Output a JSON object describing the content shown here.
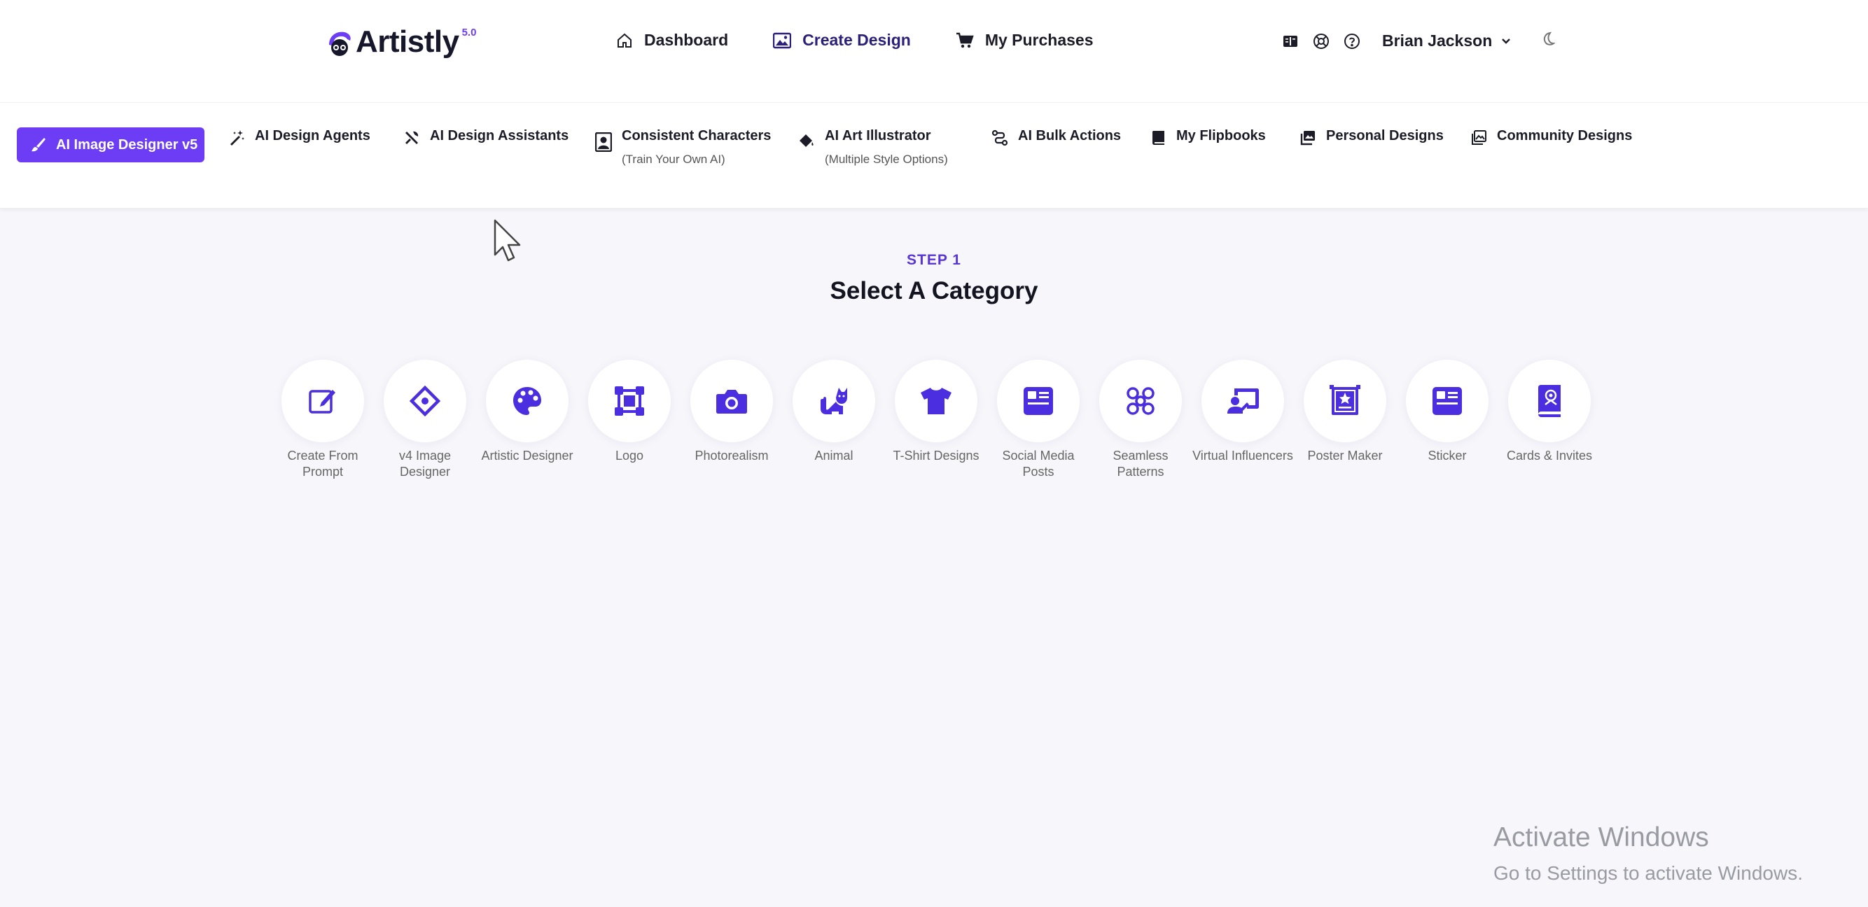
{
  "brand": {
    "name": "Artistly",
    "version": "5.0",
    "accent": "#6d3df5"
  },
  "top_nav": [
    {
      "label": "Dashboard",
      "icon": "home-icon"
    },
    {
      "label": "Create Design",
      "icon": "image-icon",
      "active": true
    },
    {
      "label": "My Purchases",
      "icon": "cart-icon"
    }
  ],
  "top_utils": {
    "icons": [
      "book-icon",
      "support-icon",
      "help-icon"
    ],
    "user_name": "Brian Jackson",
    "theme_icon": "moon-icon"
  },
  "tabs": [
    {
      "label": "AI Image Designer v5",
      "icon": "brush-icon",
      "active": true
    },
    {
      "label": "AI Design Agents",
      "icon": "magic-wand-icon"
    },
    {
      "label": "AI Design Assistants",
      "icon": "tools-icon"
    },
    {
      "label": "Consistent Characters",
      "sub": "(Train Your Own AI)",
      "icon": "portrait-icon"
    },
    {
      "label": "AI Art Illustrator",
      "sub": "(Multiple Style Options)",
      "icon": "paint-bucket-icon"
    },
    {
      "label": "AI Bulk Actions",
      "icon": "route-icon"
    },
    {
      "label": "My Flipbooks",
      "icon": "book-icon"
    },
    {
      "label": "Personal Designs",
      "icon": "images-icon"
    },
    {
      "label": "Community Designs",
      "icon": "gallery-icon"
    }
  ],
  "main": {
    "step": "STEP 1",
    "heading": "Select A Category"
  },
  "categories": [
    {
      "label": "Create From Prompt",
      "icon": "edit-icon"
    },
    {
      "label": "v4 Image Designer",
      "icon": "diamond-icon"
    },
    {
      "label": "Artistic Designer",
      "icon": "palette-icon"
    },
    {
      "label": "Logo",
      "icon": "vector-square-icon"
    },
    {
      "label": "Photorealism",
      "icon": "camera-icon"
    },
    {
      "label": "Animal",
      "icon": "cat-icon"
    },
    {
      "label": "T-Shirt Designs",
      "icon": "tshirt-icon"
    },
    {
      "label": "Social Media Posts",
      "icon": "news-card-icon"
    },
    {
      "label": "Seamless Patterns",
      "icon": "pattern-icon"
    },
    {
      "label": "Virtual Influencers",
      "icon": "presenter-icon"
    },
    {
      "label": "Poster Maker",
      "icon": "poster-icon"
    },
    {
      "label": "Sticker",
      "icon": "sticker-icon"
    },
    {
      "label": "Cards & Invites",
      "icon": "card-icon"
    }
  ],
  "watermark": {
    "line1": "Activate Windows",
    "line2": "Go to Settings to activate Windows."
  }
}
